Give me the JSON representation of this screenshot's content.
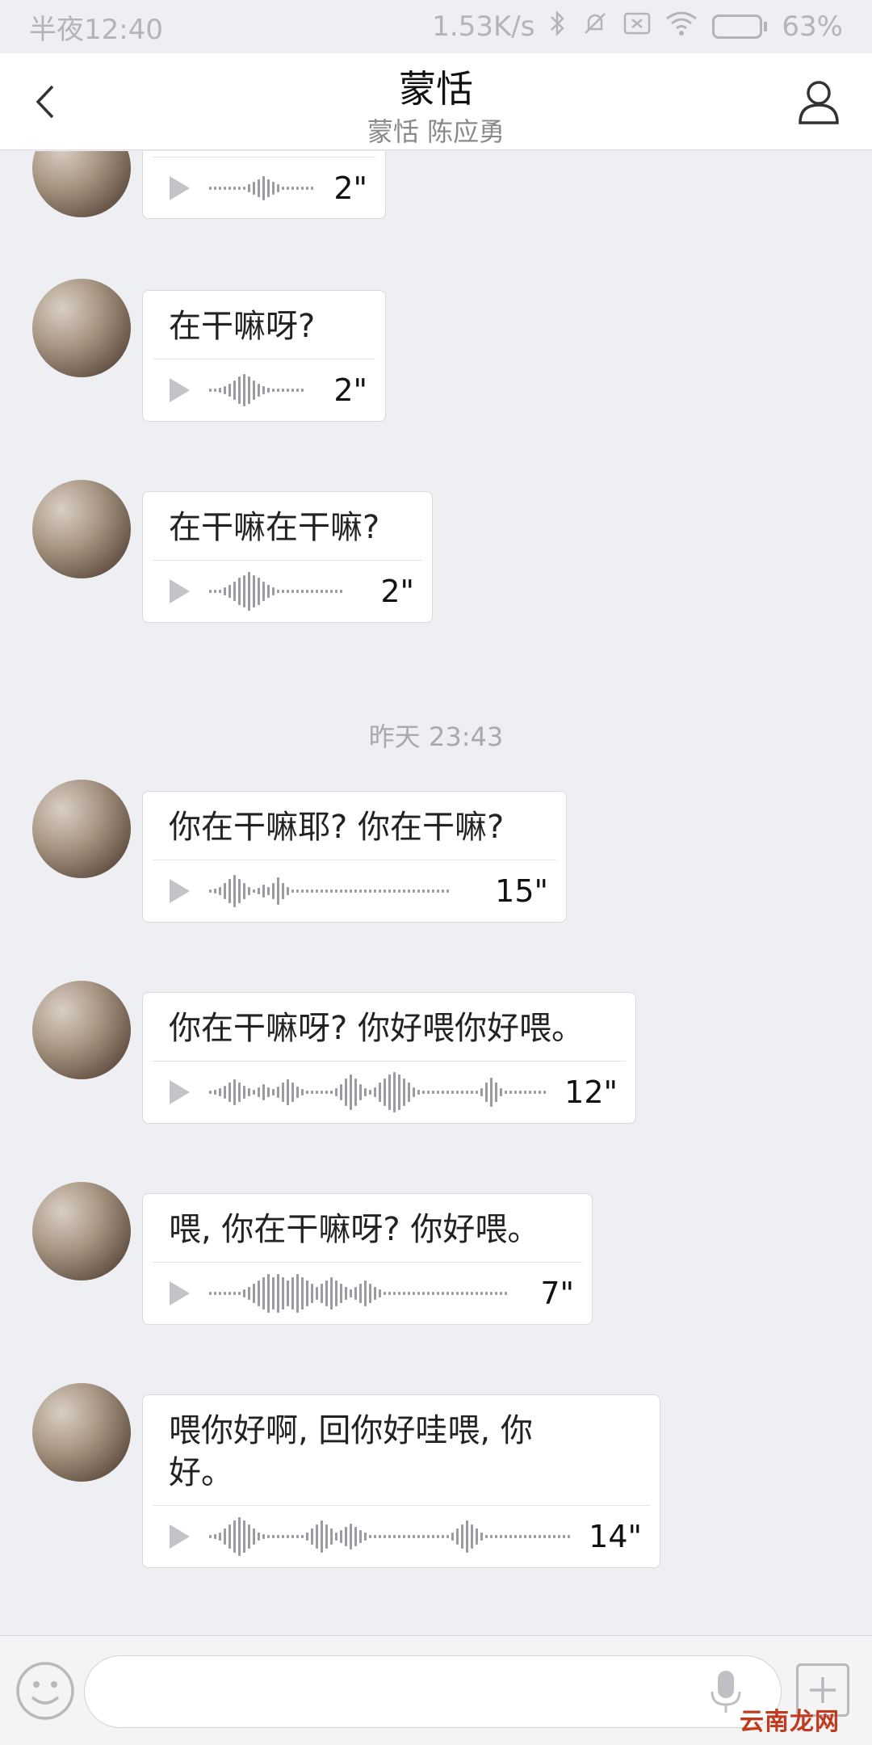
{
  "status_bar": {
    "time": "半夜12:40",
    "network_speed": "1.53K/s",
    "battery_percent": "63%",
    "battery_level": 0.63,
    "icons": [
      "bluetooth-icon",
      "mute-icon",
      "sim-icon",
      "wifi-icon",
      "battery-icon"
    ]
  },
  "header": {
    "title": "蒙恬",
    "subtitle": "蒙恬 陈应勇",
    "back_icon": "chevron-left-icon",
    "profile_icon": "person-icon"
  },
  "messages": [
    {
      "text": "",
      "duration": "2\"",
      "partial": true
    },
    {
      "text": "在干嘛呀?",
      "duration": "2\""
    },
    {
      "text": "在干嘛在干嘛?",
      "duration": "2\""
    },
    {
      "text": "你在干嘛耶? 你在干嘛?",
      "duration": "15\""
    },
    {
      "text": "你在干嘛呀? 你好喂你好喂。",
      "duration": "12\""
    },
    {
      "text": "喂, 你在干嘛呀? 你好喂。",
      "duration": "7\""
    },
    {
      "text": "喂你好啊, 回你好哇喂, 你好。",
      "duration": "14\""
    }
  ],
  "timestamp": "昨天 23:43",
  "input_bar": {
    "emoji_icon": "emoji-icon",
    "mic_icon": "microphone-icon",
    "plus_icon": "plus-icon",
    "placeholder": ""
  },
  "watermark": "云南龙网",
  "colors": {
    "background": "#eeeff3",
    "bubble": "#ffffff",
    "watermark": "#c23a1d"
  }
}
